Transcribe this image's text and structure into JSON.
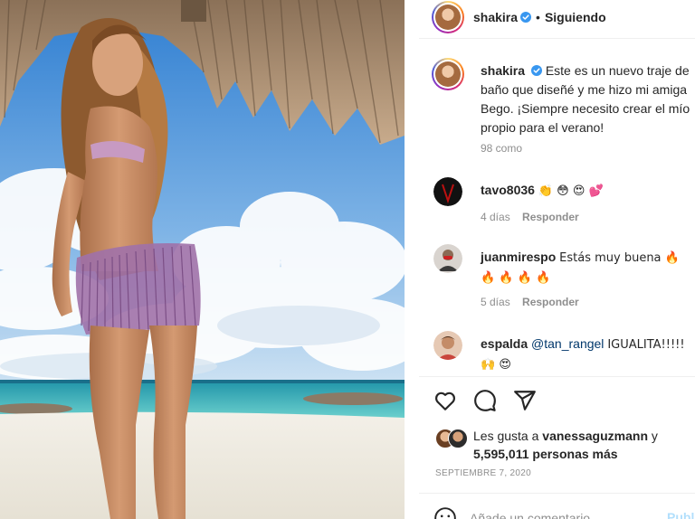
{
  "post": {
    "username": "shakira",
    "follow_state": "Siguiendo",
    "separator": "•",
    "caption": "Este es un nuevo traje de baño que diseñé y me hizo mi amiga Bego. ¡Siempre necesito crear el mío propio para el verano!",
    "caption_likes": "98 como",
    "comments": [
      {
        "username": "tavo8036",
        "text": "👏 😳 😍 💕",
        "age": "4 días",
        "reply": "Responder"
      },
      {
        "username": "juanmirespo",
        "text": "Estás muy buena 🔥 🔥 🔥 🔥 🔥",
        "age": "5 días",
        "reply": "Responder"
      },
      {
        "username": "espalda",
        "mention": "@tan_rangel",
        "text": "IGUALITA!!!!! 🙌 😍"
      }
    ],
    "liked_by_prefix": "Les gusta a",
    "liked_by_user": "vanessaguzmann",
    "liked_by_conj": "y",
    "liked_by_others": "5,595,011 personas más",
    "date": "SEPTIEMBRE 7, 2020",
    "add_comment_placeholder": "Añade un comentario...",
    "publish_label": "Publicar"
  },
  "icons": {
    "verified": "verified-badge-icon",
    "like": "heart-icon",
    "comment": "comment-bubble-icon",
    "share": "paper-plane-icon",
    "emoji": "smiley-icon"
  },
  "colors": {
    "verified_blue": "#3897f0",
    "text": "#262626",
    "muted": "#8e8e8e",
    "publish_disabled": "#b2dffc",
    "mention": "#00376b"
  }
}
